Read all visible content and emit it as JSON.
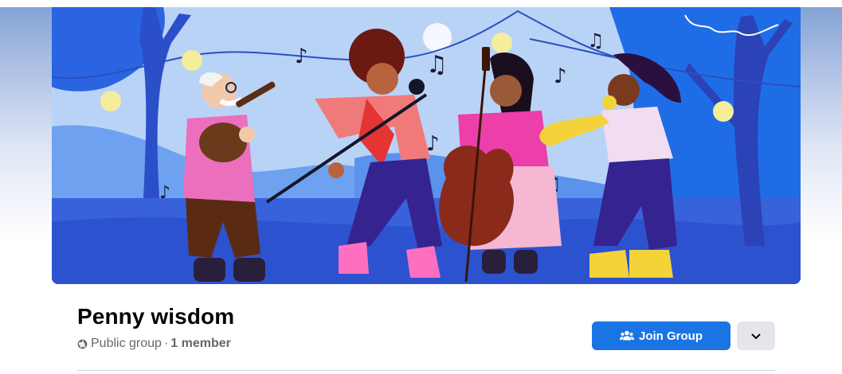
{
  "group": {
    "name": "Penny wisdom",
    "privacy": "Public group",
    "separator": "·",
    "members": "1 member"
  },
  "actions": {
    "join_label": "Join Group"
  },
  "icons": {
    "privacy": "globe-icon",
    "join": "people-icon",
    "more": "chevron-down-icon"
  },
  "colors": {
    "primary": "#1b74e4",
    "secondary_button": "#e4e6eb",
    "title": "#050505",
    "meta": "#65676b",
    "cover_sky": "#b9d3f7",
    "cover_ground": "#2f55d4"
  }
}
